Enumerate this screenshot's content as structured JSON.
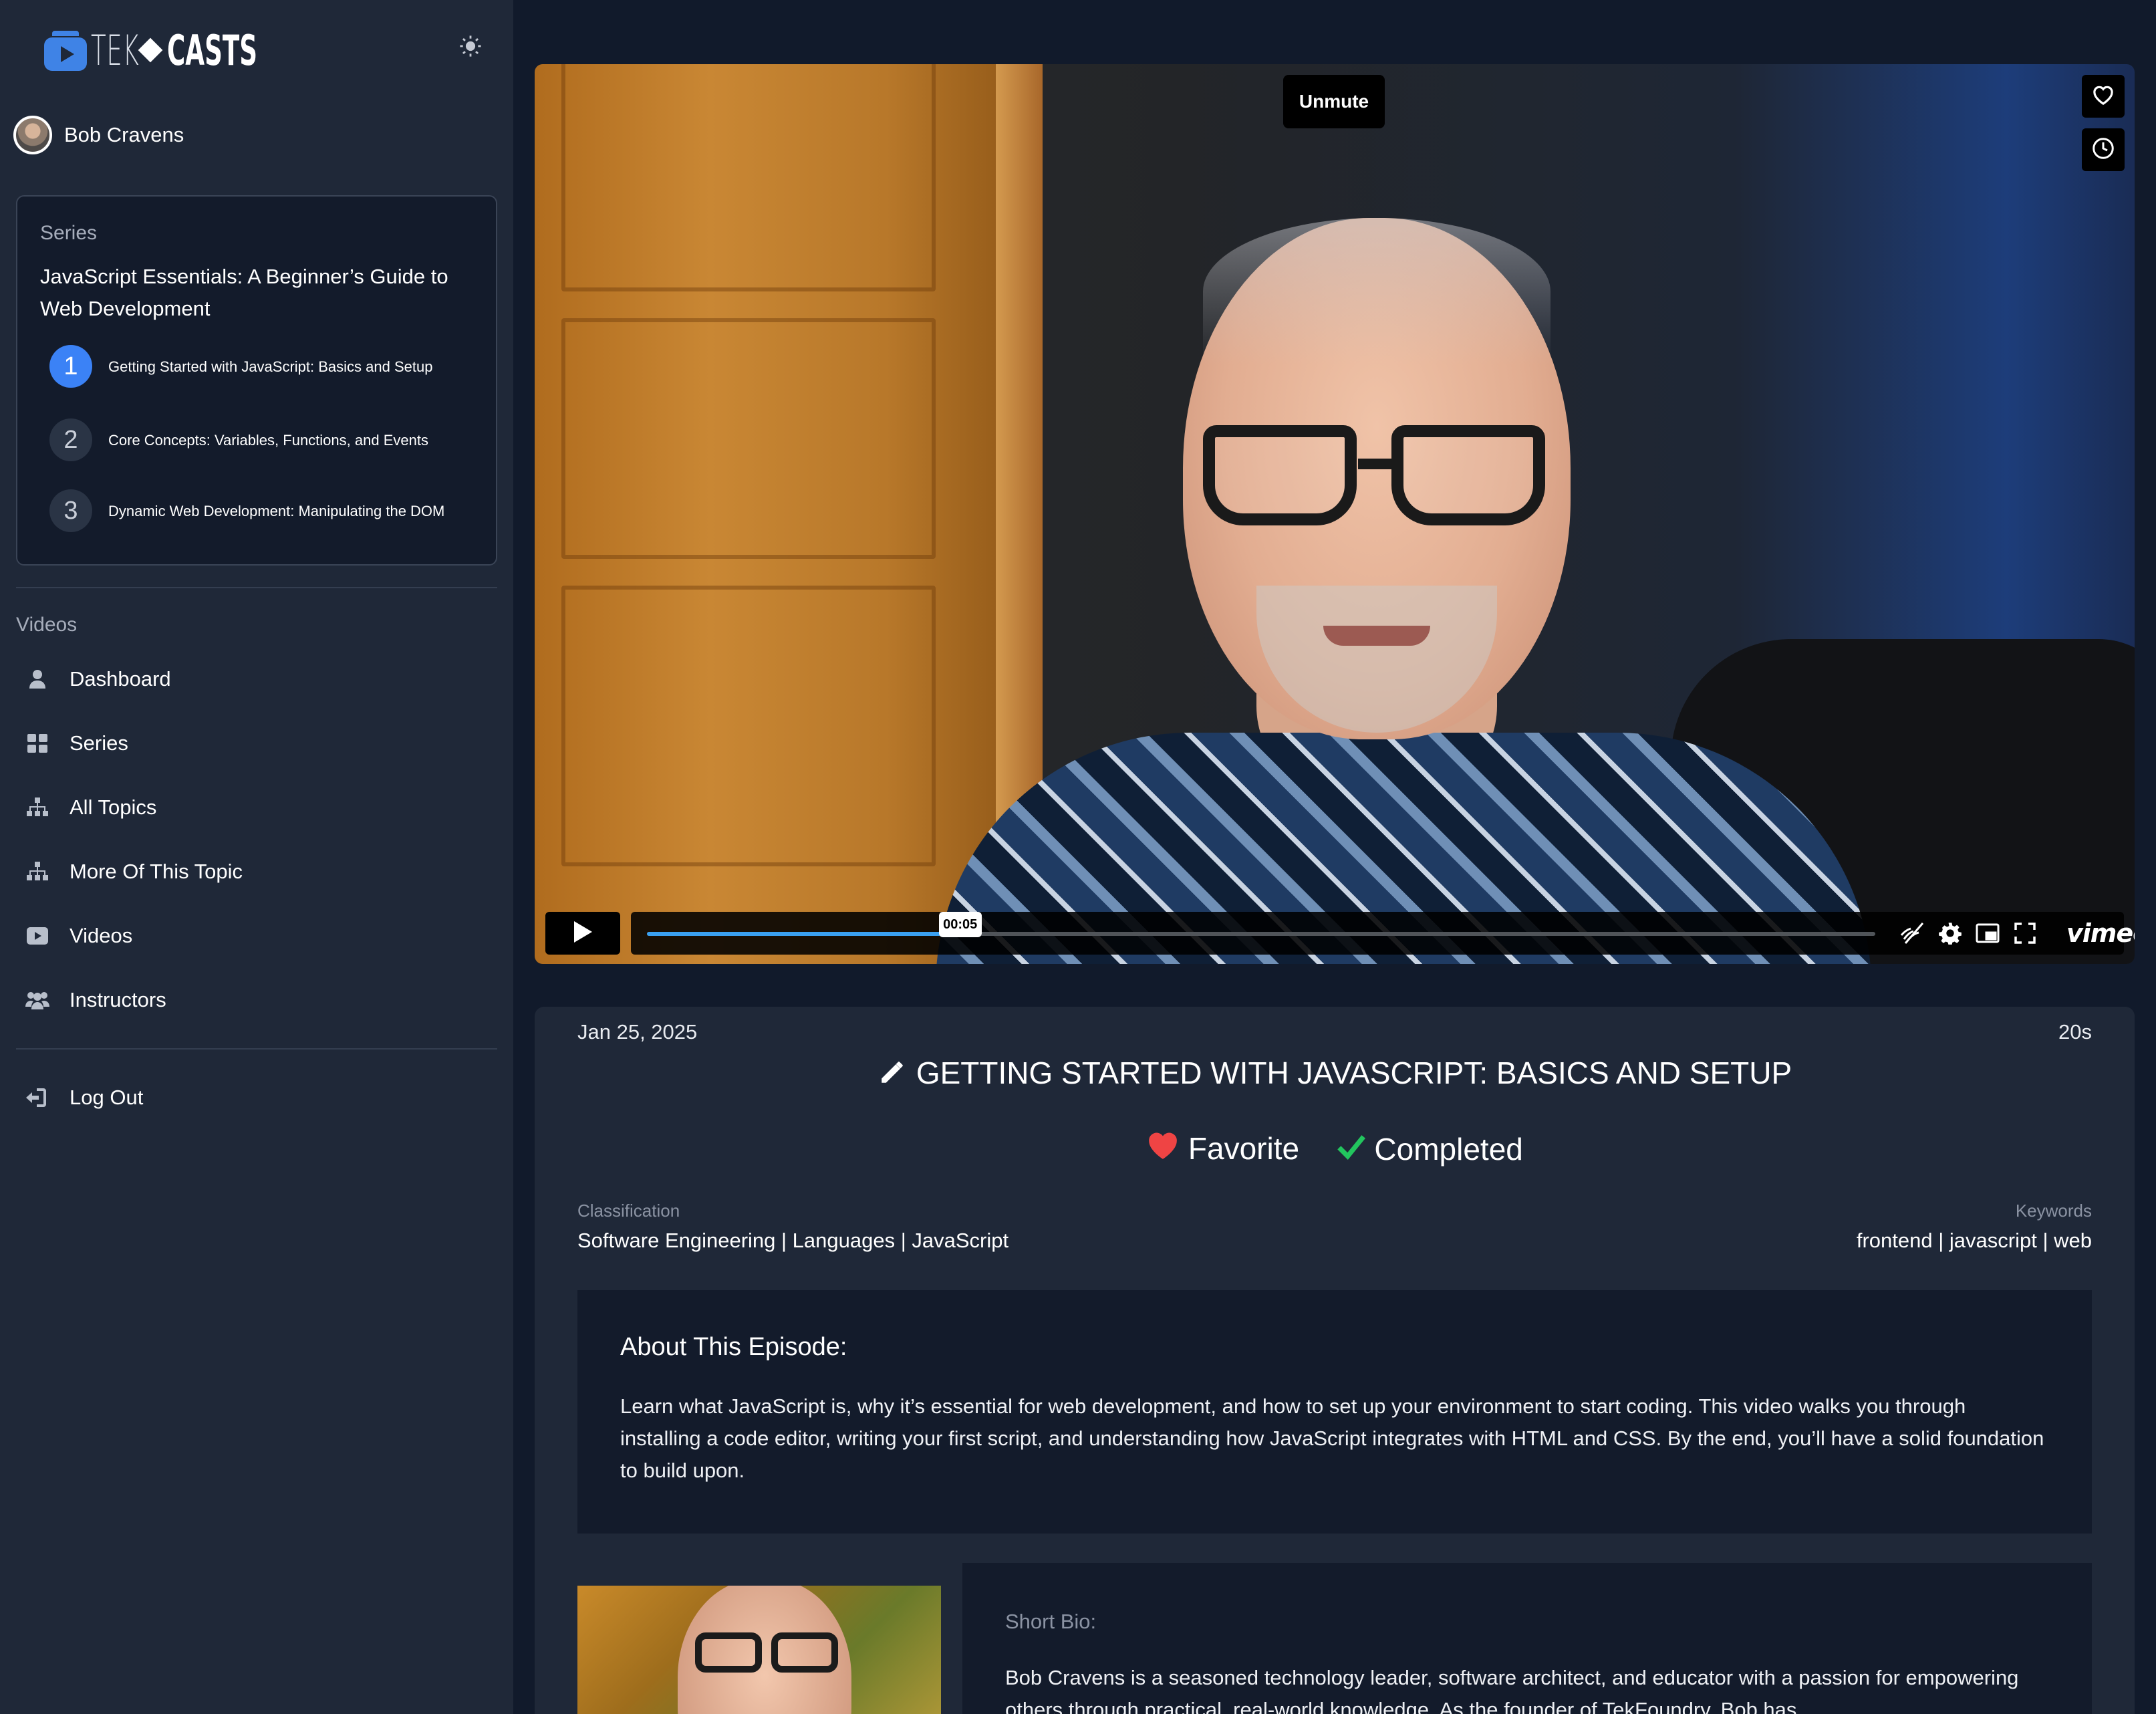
{
  "app": {
    "logo_text_light": "TEK",
    "logo_text_bold": "CASTS",
    "theme_icon": "sun-icon"
  },
  "user": {
    "name": "Bob Cravens"
  },
  "series": {
    "label": "Series",
    "title": "JavaScript Essentials: A Beginner’s Guide to Web Development",
    "episodes": [
      {
        "num": "1",
        "title": "Getting Started with JavaScript: Basics and Setup",
        "active": true
      },
      {
        "num": "2",
        "title": "Core Concepts: Variables, Functions, and Events",
        "active": false
      },
      {
        "num": "3",
        "title": "Dynamic Web Development: Manipulating the DOM",
        "active": false
      }
    ]
  },
  "nav": {
    "section_label": "Videos",
    "items": [
      {
        "label": "Dashboard",
        "icon": "user-icon"
      },
      {
        "label": "Series",
        "icon": "grid-icon"
      },
      {
        "label": "All Topics",
        "icon": "sitemap-icon"
      },
      {
        "label": "More Of This Topic",
        "icon": "sitemap-icon"
      },
      {
        "label": "Videos",
        "icon": "video-icon"
      },
      {
        "label": "Instructors",
        "icon": "users-icon"
      }
    ],
    "logout": {
      "label": "Log Out",
      "icon": "logout-icon"
    }
  },
  "player": {
    "unmute_label": "Unmute",
    "current_time": "00:05",
    "progress": 0.255,
    "brand": "vimeo",
    "colors": {
      "progress": "#3aa0f0"
    }
  },
  "episode": {
    "date": "Jan 25, 2025",
    "duration": "20s",
    "title": "GETTING STARTED WITH JAVASCRIPT: BASICS AND SETUP",
    "favorite_label": "Favorite",
    "completed_label": "Completed",
    "classification_label": "Classification",
    "classification_value": "Software Engineering | Languages | JavaScript",
    "keywords_label": "Keywords",
    "keywords_value": "frontend | javascript | web",
    "about_heading": "About This Episode:",
    "about_text": "Learn what JavaScript is, why it’s essential for web development, and how to set up your environment to start coding. This video walks you through installing a code editor, writing your first script, and understanding how JavaScript integrates with HTML and CSS. By the end, you’ll have a solid foundation to build upon.",
    "bio_label": "Short Bio:",
    "bio_text": "Bob Cravens is a seasoned technology leader, software architect, and educator with a passion for empowering others through practical, real-world knowledge. As the founder of TekFoundry, Bob has",
    "colors": {
      "favorite": "#ef4444",
      "completed": "#22c55e"
    }
  }
}
